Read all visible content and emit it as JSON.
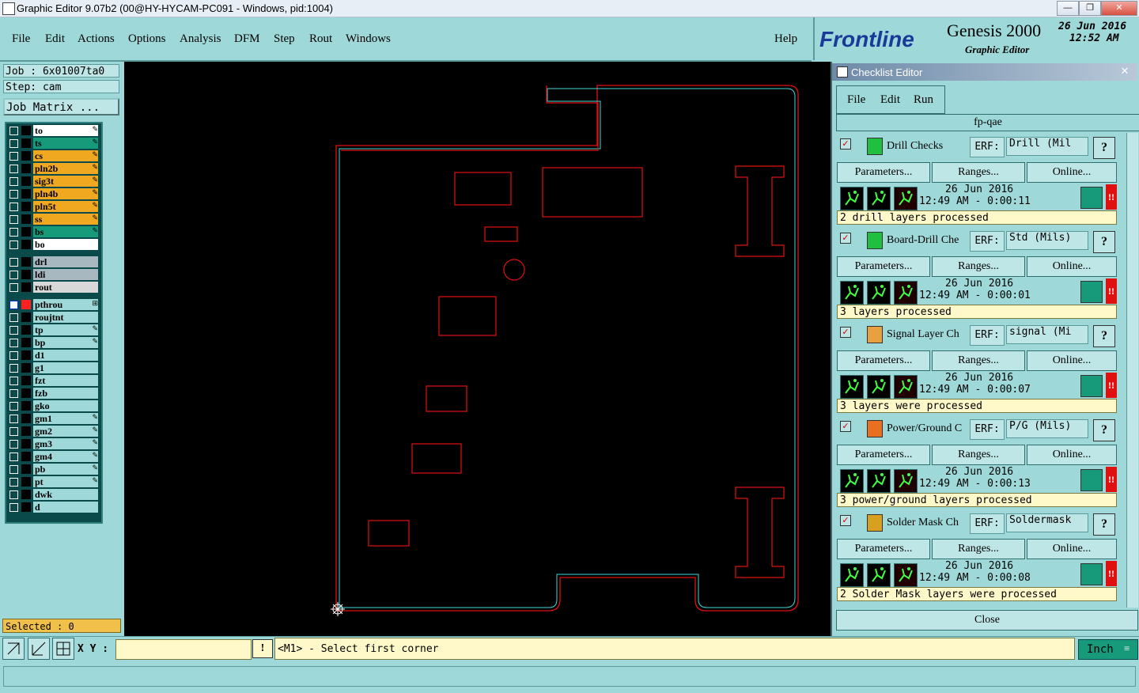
{
  "window": {
    "title": "Graphic Editor 9.07b2 (00@HY-HYCAM-PC091 - Windows, pid:1004)",
    "controls": [
      "—",
      "❐",
      "✕"
    ]
  },
  "menu": {
    "items": [
      "File",
      "Edit",
      "Actions",
      "Options",
      "Analysis",
      "DFM",
      "Step",
      "Rout",
      "Windows"
    ],
    "help": "Help"
  },
  "brand": {
    "logo_text": "Frontline",
    "product": "Genesis 2000",
    "subtitle": "Graphic Editor",
    "date": "26 Jun 2016",
    "time": "12:52 AM"
  },
  "job": {
    "job_label": "Job : 6x01007ta0",
    "step_label": "Step: cam",
    "matrix_button": "Job Matrix ..."
  },
  "layers": [
    {
      "name": "to",
      "color": "#ffffff",
      "flag": "✎"
    },
    {
      "name": "ts",
      "color": "#169a7a",
      "flag": "✎"
    },
    {
      "name": "cs",
      "color": "#f0a820",
      "flag": "✎"
    },
    {
      "name": "pln2b",
      "color": "#f0a820",
      "flag": "✎"
    },
    {
      "name": "sig3t",
      "color": "#f0a820",
      "flag": "✎"
    },
    {
      "name": "pln4b",
      "color": "#f0a820",
      "flag": "✎"
    },
    {
      "name": "pln5t",
      "color": "#f0a820",
      "flag": "✎"
    },
    {
      "name": "ss",
      "color": "#f0a820",
      "flag": "✎"
    },
    {
      "name": "bs",
      "color": "#169a7a",
      "flag": "✎"
    },
    {
      "name": "bo",
      "color": "#ffffff",
      "flag": ""
    },
    {
      "name": "drl",
      "color": "#a8b8c0",
      "flag": ""
    },
    {
      "name": "ldi",
      "color": "#a8b8c0",
      "flag": ""
    },
    {
      "name": "rout",
      "color": "#d8d8d8",
      "flag": ""
    },
    {
      "name": "pthrou",
      "color": "#9ed8d8",
      "flag": "⊞"
    },
    {
      "name": "roujtnt",
      "color": "#9ed8d8",
      "flag": ""
    },
    {
      "name": "tp",
      "color": "#9ed8d8",
      "flag": "✎"
    },
    {
      "name": "bp",
      "color": "#9ed8d8",
      "flag": "✎"
    },
    {
      "name": "d1",
      "color": "#9ed8d8",
      "flag": ""
    },
    {
      "name": "g1",
      "color": "#9ed8d8",
      "flag": ""
    },
    {
      "name": "fzt",
      "color": "#9ed8d8",
      "flag": ""
    },
    {
      "name": "fzb",
      "color": "#9ed8d8",
      "flag": ""
    },
    {
      "name": "gko",
      "color": "#9ed8d8",
      "flag": ""
    },
    {
      "name": "gm1",
      "color": "#9ed8d8",
      "flag": "✎"
    },
    {
      "name": "gm2",
      "color": "#9ed8d8",
      "flag": "✎"
    },
    {
      "name": "gm3",
      "color": "#9ed8d8",
      "flag": "✎"
    },
    {
      "name": "gm4",
      "color": "#9ed8d8",
      "flag": "✎"
    },
    {
      "name": "pb",
      "color": "#9ed8d8",
      "flag": "✎"
    },
    {
      "name": "pt",
      "color": "#9ed8d8",
      "flag": "✎"
    },
    {
      "name": "dwk",
      "color": "#9ed8d8",
      "flag": ""
    },
    {
      "name": "d",
      "color": "#9ed8d8",
      "flag": ""
    }
  ],
  "selected": "Selected : 0",
  "status": {
    "xy_label": "X Y :",
    "xy_value": "",
    "warn": "!",
    "prompt": "<M1> - Select first corner",
    "units": "Inch"
  },
  "checklist": {
    "title": "Checklist Editor",
    "close_x": "✕",
    "menu": [
      "File",
      "Edit",
      "Run"
    ],
    "name": "fp-qae",
    "erf_label": "ERF:",
    "help": "?",
    "parameters": "Parameters...",
    "ranges": "Ranges...",
    "online": "Online...",
    "close": "Close",
    "items": [
      {
        "name": "Drill Checks",
        "erf": "Drill (Mil",
        "date": "26 Jun 2016",
        "time": "12:49 AM - 0:00:11",
        "message": "2 drill layers processed",
        "icon_color": "#1fbf3f"
      },
      {
        "name": "Board-Drill Che",
        "erf": "Std (Mils)",
        "date": "26 Jun 2016",
        "time": "12:49 AM - 0:00:01",
        "message": "3 layers processed",
        "icon_color": "#1fbf3f"
      },
      {
        "name": "Signal Layer Ch",
        "erf": "signal (Mi",
        "date": "26 Jun 2016",
        "time": "12:49 AM - 0:00:07",
        "message": "3 layers were processed",
        "icon_color": "#e8a040"
      },
      {
        "name": "Power/Ground C",
        "erf": "P/G (Mils)",
        "date": "26 Jun 2016",
        "time": "12:49 AM - 0:00:13",
        "message": "3 power/ground layers processed",
        "icon_color": "#e87020"
      },
      {
        "name": "Solder Mask Ch",
        "erf": "Soldermask",
        "date": "26 Jun 2016",
        "time": "12:49 AM - 0:00:08",
        "message": "2 Solder Mask layers were processed",
        "icon_color": "#d8a020"
      }
    ]
  }
}
